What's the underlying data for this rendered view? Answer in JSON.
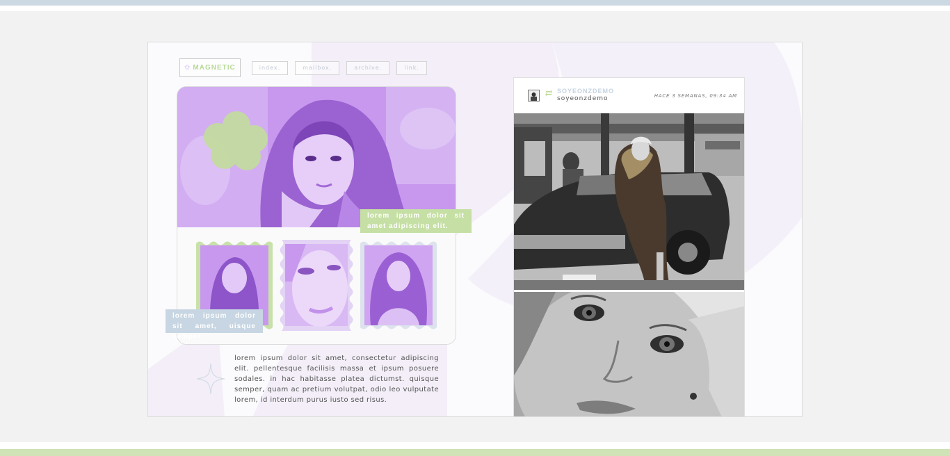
{
  "nav": {
    "brand": "MAGNETIC",
    "brand_icon": "star-icon",
    "links": [
      "index.",
      "mailbox.",
      "archive.",
      "link."
    ]
  },
  "captions": {
    "green": "lorem ipsum dolor sit amet adipiscing elit.",
    "blue": "lorem ipsum dolor sit amet, uisque semper."
  },
  "body_text": "lorem ipsum dolor sit amet, consectetur adipiscing elit. pellentesque facilisis massa et ipsum posuere sodales. in hac habitasse platea dictumst. quisque semper, quam ac pretium volutpat, odio leo vulputate lorem, id interdum purus iusto sed risus.",
  "post": {
    "username": "SOYEONZDEMO",
    "username_sub": "soyeonzdemo",
    "timestamp": "HACE 3 SEMANAS, 09:34 AM"
  },
  "colors": {
    "purple": "#c898ef",
    "green": "#c5dfa4",
    "blue": "#c7d6e2",
    "background": "#f2f2f2"
  }
}
